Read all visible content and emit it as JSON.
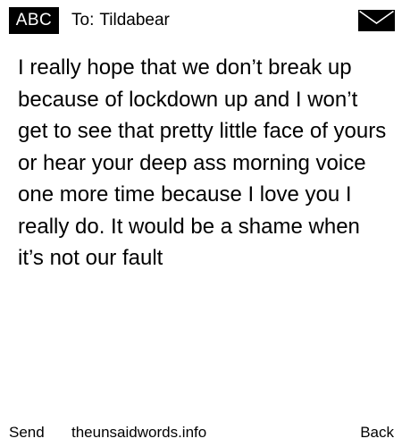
{
  "header": {
    "mode_badge": "ABC",
    "recipient_label": "To:",
    "recipient_name": "Tildabear",
    "icon": "envelope-icon"
  },
  "message": {
    "body": "I really hope that we don’t break up because of lockdown up and I won’t get to see that pretty little face of yours or hear your deep ass morning voice one more time because I love you I really do. It would be a shame when it’s not our fault"
  },
  "footer": {
    "send_label": "Send",
    "site_label": "theunsaidwords.info",
    "back_label": "Back"
  },
  "colors": {
    "background": "#ffffff",
    "foreground": "#000000"
  }
}
